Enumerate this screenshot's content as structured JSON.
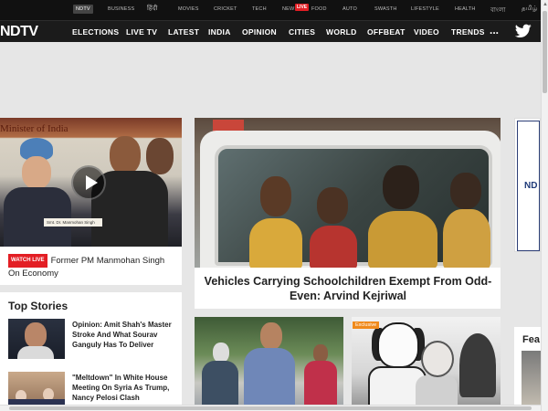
{
  "topbar": {
    "links": [
      "NDTV",
      "BUSINESS",
      "हिंदी",
      "MOVIES",
      "CRICKET",
      "TECH",
      "NEWS",
      "FOOD",
      "AUTO",
      "SWASTH",
      "LIFESTYLE",
      "HEALTH",
      "বাংলা",
      "தமிழ்"
    ],
    "live_badge": "LIVE"
  },
  "nav": {
    "logo": "NDTV",
    "items": [
      "ELECTIONS",
      "LIVE TV",
      "LATEST",
      "INDIA",
      "OPINION",
      "CITIES",
      "WORLD",
      "OFFBEAT",
      "VIDEO",
      "TRENDS"
    ],
    "more": "...",
    "social_icon": "twitter-icon"
  },
  "video_card": {
    "banner_text": "Minister of India",
    "nameplate": "Smt. Dr. Manmohan Singh",
    "watch_live": "WATCH LIVE",
    "caption": "Former PM Manmohan Singh On Economy"
  },
  "main_story": {
    "headline": "Vehicles Carrying Schoolchildren Exempt From Odd-Even: Arvind Kejriwal"
  },
  "right_card": {
    "text": "ND"
  },
  "top_stories": {
    "title": "Top Stories",
    "items": [
      {
        "headline": "Opinion: Amit Shah's Master Stroke And What Sourav Ganguly Has To Deliver"
      },
      {
        "headline": "\"Meltdown\" In White House Meeting On Syria As Trump, Nancy Pelosi Clash"
      }
    ]
  },
  "bottom_cards": {
    "card2_tag": "Exclusive"
  },
  "feature": {
    "title": "Fea"
  },
  "colors": {
    "accent": "#e31e24",
    "nav_bg": "#1b1b1b",
    "topbar_bg": "#111111",
    "page_bg": "#e6e6e6"
  }
}
